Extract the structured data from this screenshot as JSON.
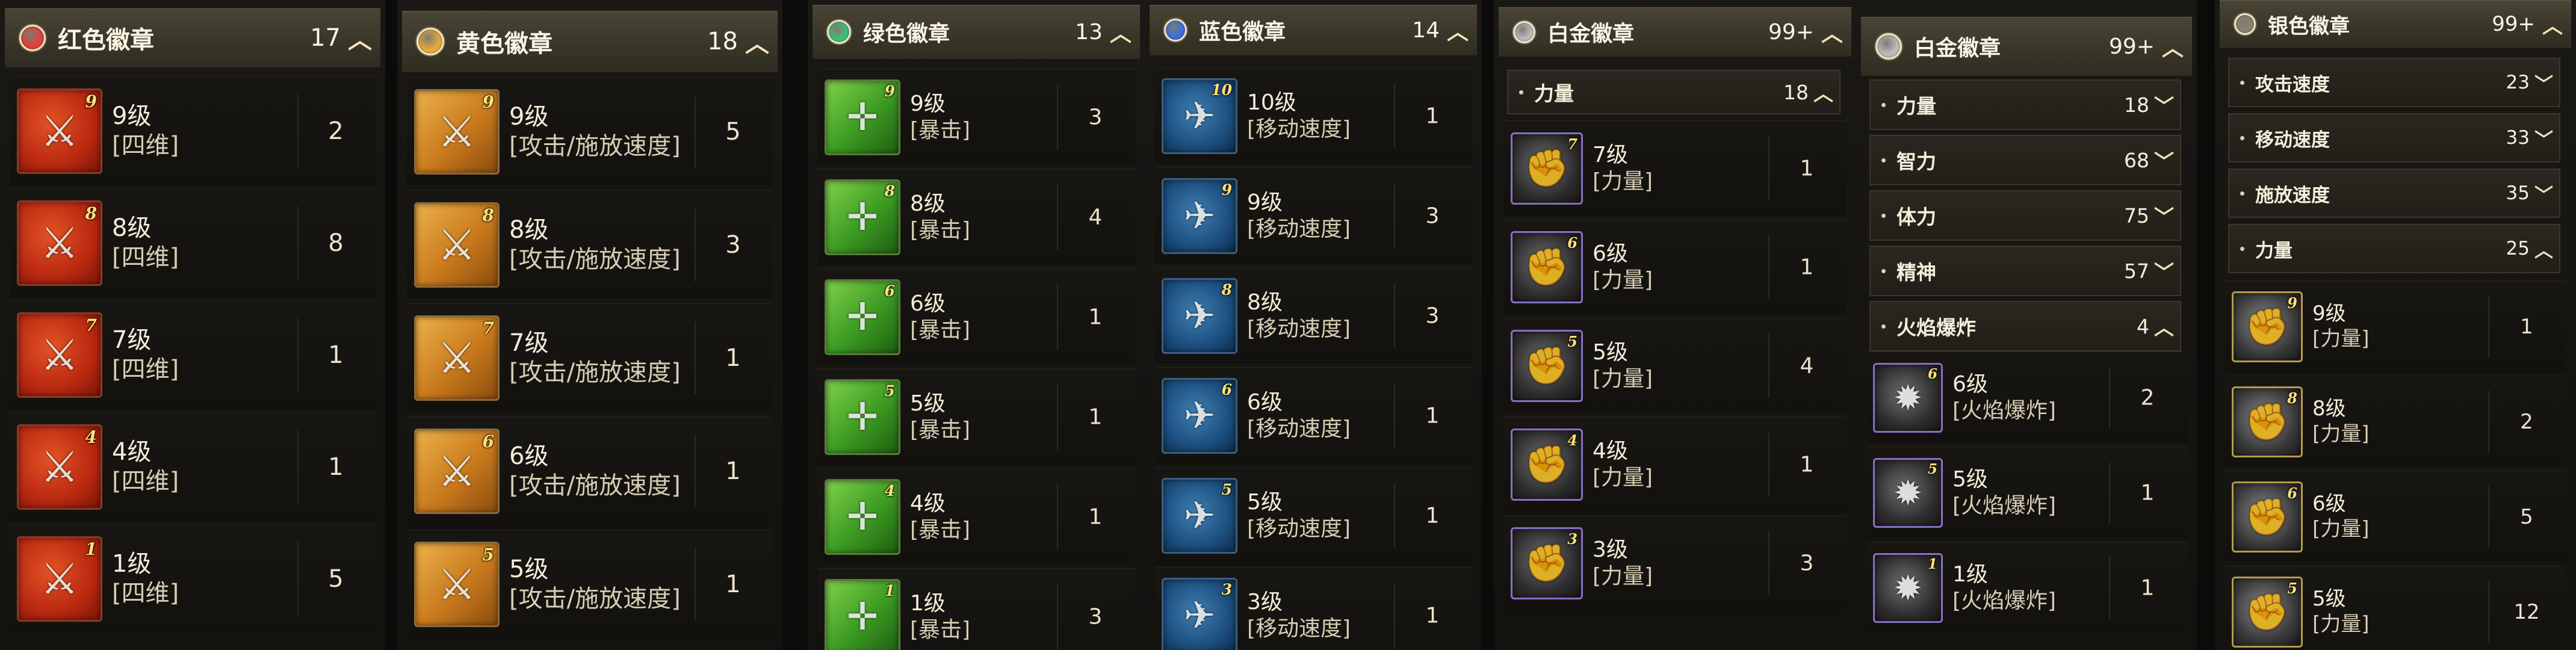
{
  "panels": [
    {
      "title": "红色徽章",
      "count": "17",
      "gem_color": "#e0413a",
      "rows": [
        {
          "level_badge": "9",
          "level": "9级",
          "stat": "[四维]",
          "qty": "2"
        },
        {
          "level_badge": "8",
          "level": "8级",
          "stat": "[四维]",
          "qty": "8"
        },
        {
          "level_badge": "7",
          "level": "7级",
          "stat": "[四维]",
          "qty": "1"
        },
        {
          "level_badge": "4",
          "level": "4级",
          "stat": "[四维]",
          "qty": "1"
        },
        {
          "level_badge": "1",
          "level": "1级",
          "stat": "[四维]",
          "qty": "5"
        }
      ]
    },
    {
      "title": "黄色徽章",
      "count": "18",
      "gem_color": "#e6a93a",
      "rows": [
        {
          "level_badge": "9",
          "level": "9级",
          "stat": "[攻击/施放速度]",
          "qty": "5"
        },
        {
          "level_badge": "8",
          "level": "8级",
          "stat": "[攻击/施放速度]",
          "qty": "3"
        },
        {
          "level_badge": "7",
          "level": "7级",
          "stat": "[攻击/施放速度]",
          "qty": "1"
        },
        {
          "level_badge": "6",
          "level": "6级",
          "stat": "[攻击/施放速度]",
          "qty": "1"
        },
        {
          "level_badge": "5",
          "level": "5级",
          "stat": "[攻击/施放速度]",
          "qty": "1"
        }
      ]
    },
    {
      "title": "绿色徽章",
      "count": "13",
      "gem_color": "#3fbf7a",
      "rows": [
        {
          "level_badge": "9",
          "level": "9级",
          "stat": "[暴击]",
          "qty": "3"
        },
        {
          "level_badge": "8",
          "level": "8级",
          "stat": "[暴击]",
          "qty": "4"
        },
        {
          "level_badge": "6",
          "level": "6级",
          "stat": "[暴击]",
          "qty": "1"
        },
        {
          "level_badge": "5",
          "level": "5级",
          "stat": "[暴击]",
          "qty": "1"
        },
        {
          "level_badge": "4",
          "level": "4级",
          "stat": "[暴击]",
          "qty": "1"
        },
        {
          "level_badge": "1",
          "level": "1级",
          "stat": "[暴击]",
          "qty": "3"
        }
      ]
    },
    {
      "title": "蓝色徽章",
      "count": "14",
      "gem_color": "#3a6fe0",
      "rows": [
        {
          "level_badge": "10",
          "level": "10级",
          "stat": "[移动速度]",
          "qty": "1"
        },
        {
          "level_badge": "9",
          "level": "9级",
          "stat": "[移动速度]",
          "qty": "3"
        },
        {
          "level_badge": "8",
          "level": "8级",
          "stat": "[移动速度]",
          "qty": "3"
        },
        {
          "level_badge": "6",
          "level": "6级",
          "stat": "[移动速度]",
          "qty": "1"
        },
        {
          "level_badge": "5",
          "level": "5级",
          "stat": "[移动速度]",
          "qty": "1"
        },
        {
          "level_badge": "3",
          "level": "3级",
          "stat": "[移动速度]",
          "qty": "1"
        }
      ]
    },
    {
      "title": "白金徽章",
      "count": "99+",
      "gem_color": "#bdbdbd",
      "subs": [
        {
          "label": "力量",
          "count": "18",
          "chev": "^"
        }
      ],
      "rows": [
        {
          "level_badge": "7",
          "level": "7级",
          "stat": "[力量]",
          "qty": "1"
        },
        {
          "level_badge": "6",
          "level": "6级",
          "stat": "[力量]",
          "qty": "1"
        },
        {
          "level_badge": "5",
          "level": "5级",
          "stat": "[力量]",
          "qty": "4"
        },
        {
          "level_badge": "4",
          "level": "4级",
          "stat": "[力量]",
          "qty": "1"
        },
        {
          "level_badge": "3",
          "level": "3级",
          "stat": "[力量]",
          "qty": "3"
        }
      ]
    },
    {
      "title": "白金徽章",
      "count": "99+",
      "gem_color": "#bdbdbd",
      "subs": [
        {
          "label": "力量",
          "count": "18",
          "chev": "v"
        },
        {
          "label": "智力",
          "count": "68",
          "chev": "v"
        },
        {
          "label": "体力",
          "count": "75",
          "chev": "v"
        },
        {
          "label": "精神",
          "count": "57",
          "chev": "v"
        },
        {
          "label": "火焰爆炸",
          "count": "4",
          "chev": "^"
        }
      ],
      "rows": [
        {
          "level_badge": "6",
          "level": "6级",
          "stat": "[火焰爆炸]",
          "qty": "2"
        },
        {
          "level_badge": "5",
          "level": "5级",
          "stat": "[火焰爆炸]",
          "qty": "1"
        },
        {
          "level_badge": "1",
          "level": "1级",
          "stat": "[火焰爆炸]",
          "qty": "1"
        }
      ]
    },
    {
      "title": "银色徽章",
      "count": "99+",
      "gem_color": "#8a8470",
      "subs": [
        {
          "label": "攻击速度",
          "count": "23",
          "chev": "v"
        },
        {
          "label": "移动速度",
          "count": "33",
          "chev": "v"
        },
        {
          "label": "施放速度",
          "count": "35",
          "chev": "v"
        },
        {
          "label": "力量",
          "count": "25",
          "chev": "^"
        }
      ],
      "rows": [
        {
          "level_badge": "9",
          "level": "9级",
          "stat": "[力量]",
          "qty": "1"
        },
        {
          "level_badge": "8",
          "level": "8级",
          "stat": "[力量]",
          "qty": "2"
        },
        {
          "level_badge": "6",
          "level": "6级",
          "stat": "[力量]",
          "qty": "5"
        },
        {
          "level_badge": "5",
          "level": "5级",
          "stat": "[力量]",
          "qty": "12"
        }
      ]
    }
  ]
}
